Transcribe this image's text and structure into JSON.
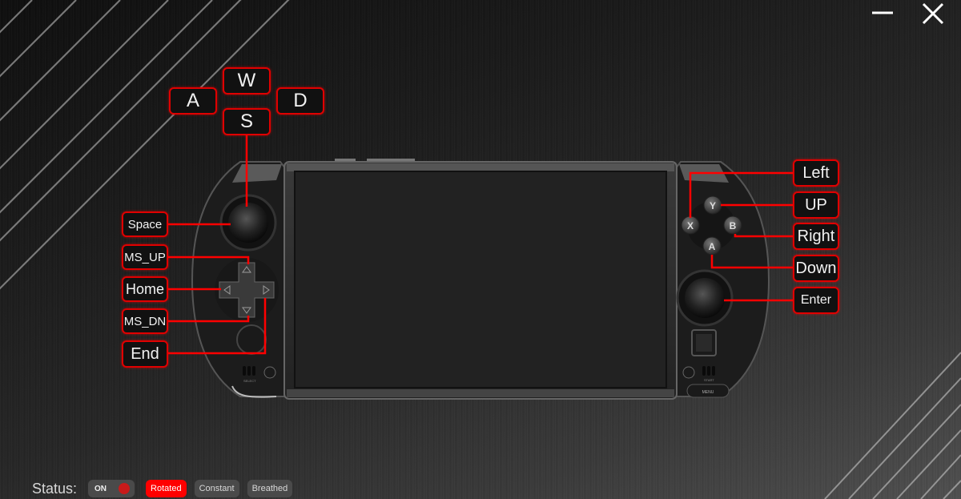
{
  "window": {
    "minimize_icon": "minus-icon",
    "close_icon": "close-x-icon"
  },
  "colors": {
    "accent": "#e00000",
    "active_mode": "#ff0000",
    "toggle_dot": "#c81a1a",
    "button_bg": "#4a4a4a"
  },
  "mappings": {
    "wasd": {
      "up": "W",
      "left": "A",
      "right": "D",
      "down": "S"
    },
    "left_side": {
      "left_stick_press": "Space",
      "dpad_up": "MS_UP",
      "dpad_left": "Home",
      "dpad_down": "MS_DN",
      "dpad_right": "End"
    },
    "right_side": {
      "x_button": "Left",
      "y_button": "UP",
      "b_button": "Right",
      "a_button": "Down",
      "right_stick_press": "Enter"
    }
  },
  "device": {
    "face_buttons": {
      "y": "Y",
      "x": "X",
      "b": "B",
      "a": "A"
    },
    "select_label": "SELECT",
    "start_label": "START",
    "menu_label": "MENU"
  },
  "status": {
    "label": "Status:",
    "toggle": {
      "label": "ON",
      "state": "on"
    },
    "modes": [
      {
        "label": "Rotated",
        "active": true
      },
      {
        "label": "Constant",
        "active": false
      },
      {
        "label": "Breathed",
        "active": false
      }
    ]
  }
}
